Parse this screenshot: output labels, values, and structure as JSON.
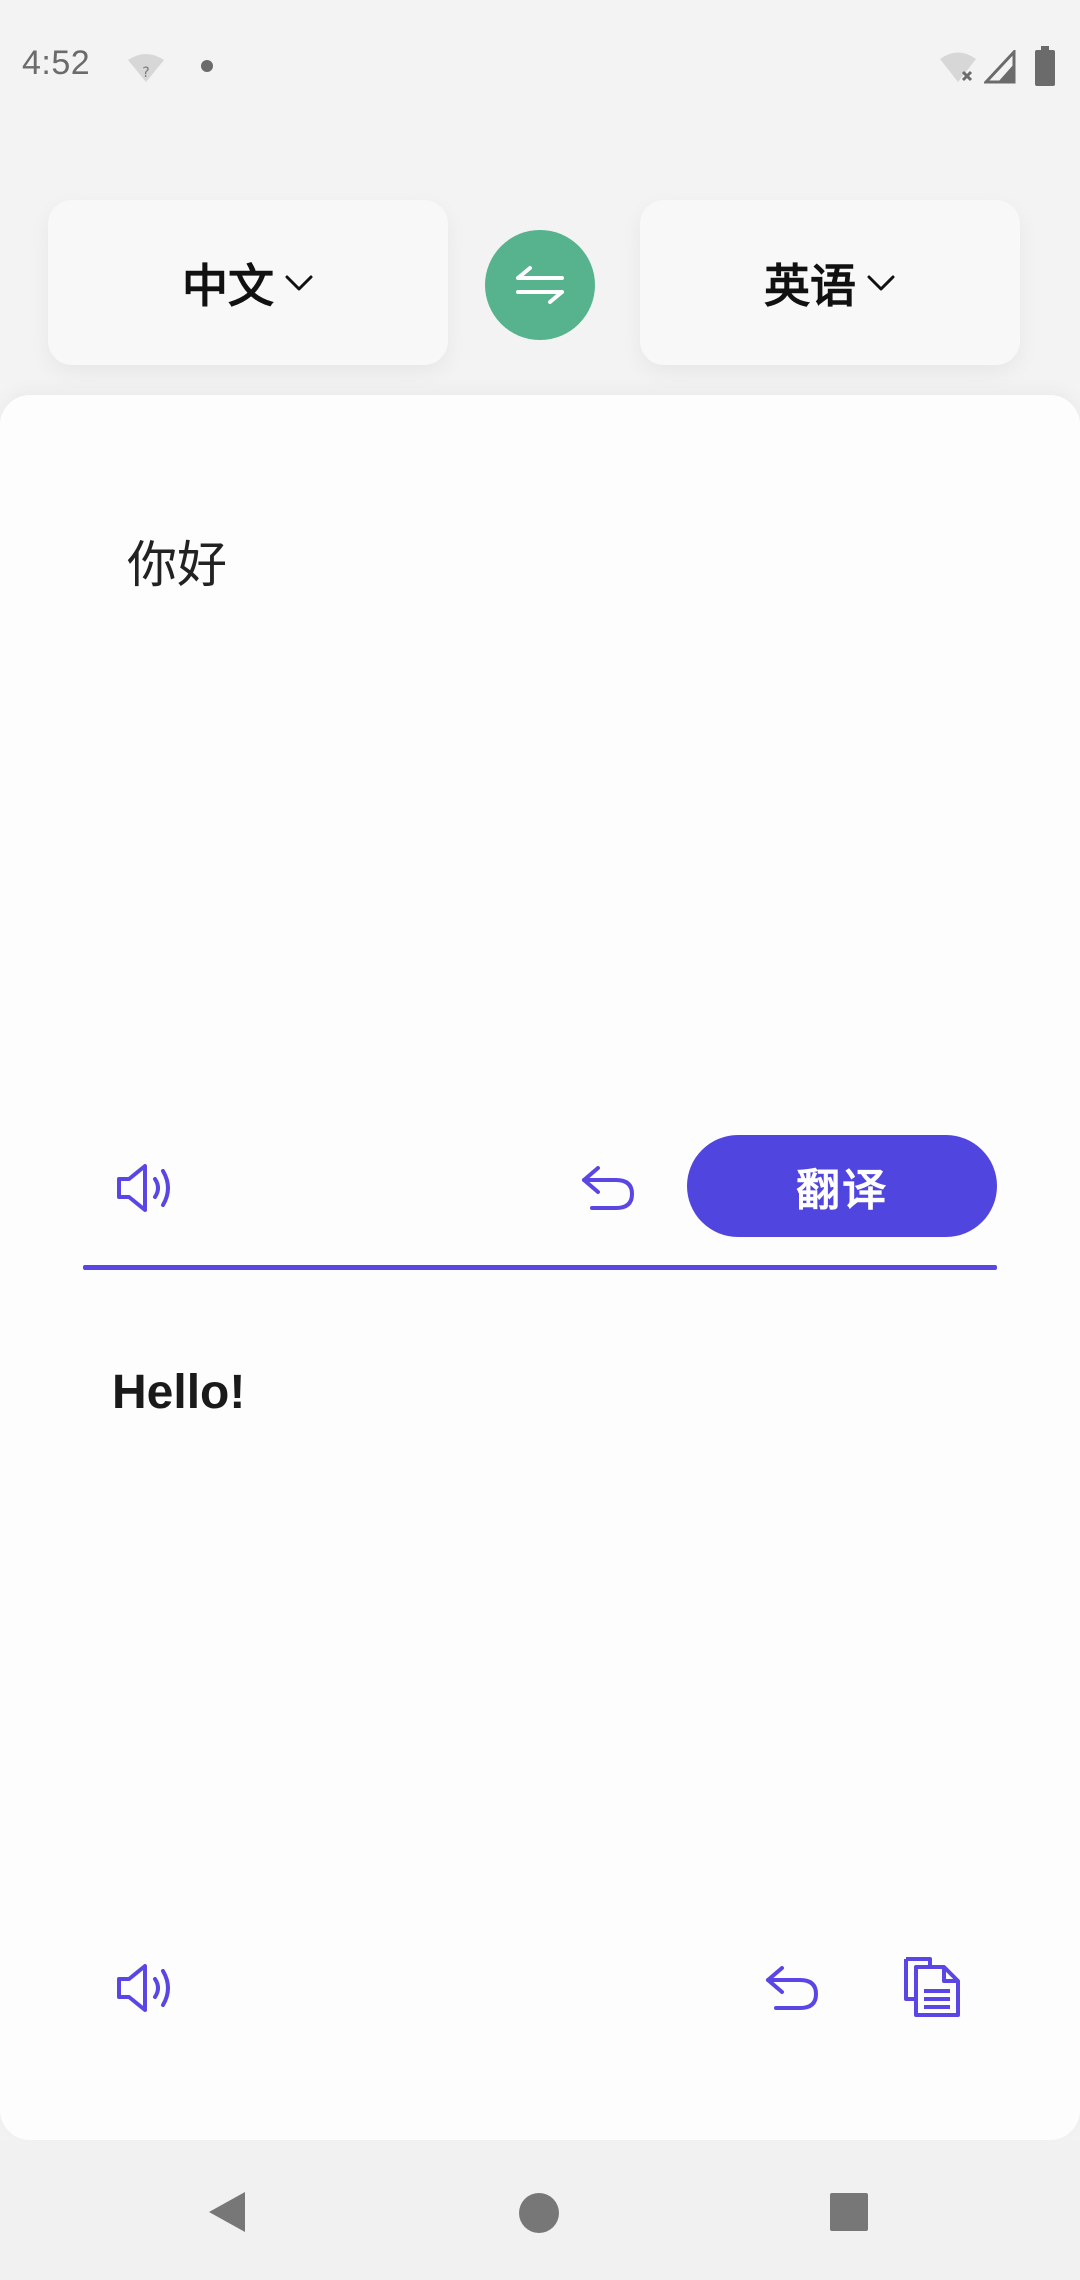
{
  "status_bar": {
    "time": "4:52",
    "icons": [
      "wifi-question-icon",
      "notification-dot-icon",
      "wifi-off-icon",
      "signal-icon",
      "battery-icon"
    ]
  },
  "language_bar": {
    "source_language": "中文",
    "target_language": "英语",
    "swap_icon": "swap-arrows-icon",
    "accent_color": "#56b38e"
  },
  "source_panel": {
    "text": "你好",
    "speak_icon": "speaker-icon",
    "undo_icon": "undo-icon",
    "translate_label": "翻译",
    "button_color": "#5145e0"
  },
  "result_panel": {
    "text": "Hello!",
    "speak_icon": "speaker-icon",
    "undo_icon": "undo-icon",
    "copy_icon": "copy-icon"
  },
  "nav_bar": {
    "icons": [
      "back-icon",
      "home-icon",
      "recents-icon"
    ]
  }
}
